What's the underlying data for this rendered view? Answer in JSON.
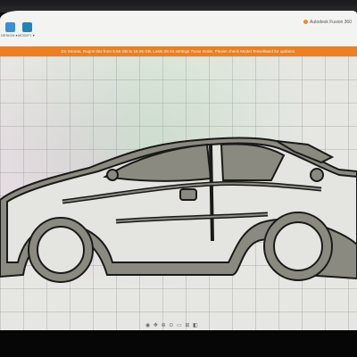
{
  "toolbar": {
    "tools": [
      {
        "label": "DESIGN ▾",
        "icon": "design-icon",
        "color": "#3a8fd6"
      },
      {
        "label": "MODIFY ▾",
        "icon": "modify-icon",
        "color": "#1f86b8"
      }
    ],
    "sign_in": "Autodesk Fusion 360"
  },
  "banner": {
    "text": "Do Seoras, Rugos this from 5.56 GB to 16.05 GB. Lasts 28 04 settings 7xxxx mode, Please check Model Tessellated for updates."
  },
  "viewport": {
    "model": "car-side-profile-outline",
    "extrusion_color": "#7d7d74",
    "edge_color": "#1a1a18"
  },
  "navbar": {
    "icons": [
      "orbit-icon",
      "pan-icon",
      "zoom-icon",
      "fit-icon",
      "view-icon",
      "grid-icon",
      "display-icon"
    ],
    "glyphs": "◉ ✥ ⊕ ⊙ ▭ ⊞ ◧"
  }
}
